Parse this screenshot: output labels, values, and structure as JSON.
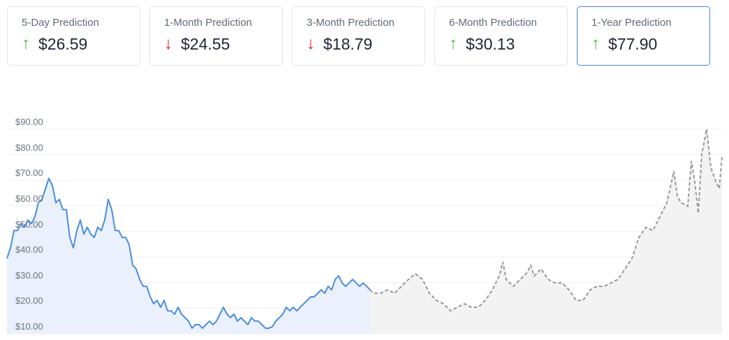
{
  "cards": [
    {
      "title": "5-Day Prediction",
      "value": "$26.59",
      "dir": "up"
    },
    {
      "title": "1-Month Prediction",
      "value": "$24.55",
      "dir": "down"
    },
    {
      "title": "3-Month Prediction",
      "value": "$18.79",
      "dir": "down"
    },
    {
      "title": "6-Month Prediction",
      "value": "$30.13",
      "dir": "up"
    },
    {
      "title": "1-Year Prediction",
      "value": "$77.90",
      "dir": "up",
      "selected": true
    }
  ],
  "arrows": {
    "up": "↑",
    "down": "↓"
  },
  "colors": {
    "historical": "#4a8ce0",
    "historical_fill": "#eaf1fc",
    "forecast": "#999999",
    "forecast_fill": "#f3f3f3",
    "grid": "#eef0f3"
  },
  "chart_data": {
    "type": "line",
    "ylim": [
      10,
      90
    ],
    "y_ticks": [
      "$10.00",
      "$20.00",
      "$30.00",
      "$40.00",
      "$50.00",
      "$60.00",
      "$70.00",
      "$80.00",
      "$90.00"
    ],
    "series": [
      {
        "name": "historical",
        "values": [
          38.9,
          43.0,
          49.8,
          49.8,
          52.5,
          51.1,
          53.9,
          52.5,
          55.2,
          60.7,
          62.0,
          66.1,
          70.2,
          67.5,
          60.7,
          62.0,
          58.0,
          58.0,
          47.1,
          43.0,
          49.8,
          53.9,
          48.4,
          51.1,
          48.4,
          47.1,
          51.1,
          49.8,
          53.9,
          62.0,
          58.0,
          49.8,
          49.8,
          47.1,
          47.1,
          44.3,
          36.2,
          34.8,
          30.7,
          28.0,
          28.0,
          23.9,
          21.2,
          22.5,
          19.8,
          22.5,
          18.4,
          18.4,
          17.1,
          19.8,
          17.1,
          15.7,
          14.4,
          11.6,
          13.0,
          13.0,
          11.6,
          13.0,
          14.4,
          13.0,
          14.4,
          17.1,
          19.8,
          17.1,
          15.7,
          17.1,
          14.4,
          15.7,
          14.4,
          13.0,
          15.7,
          14.4,
          14.4,
          13.0,
          11.6,
          11.6,
          12.2,
          14.4,
          15.7,
          17.1,
          19.8,
          18.4,
          19.8,
          18.4,
          19.8,
          21.2,
          22.5,
          23.9,
          23.9,
          25.3,
          26.6,
          25.3,
          28.0,
          26.6,
          30.7,
          32.1,
          29.3,
          28.0,
          29.3,
          30.7,
          29.3,
          28.0,
          29.3,
          28.0,
          26.6
        ]
      },
      {
        "name": "forecast",
        "points": [
          [
            104,
            26.6
          ],
          [
            105,
            25.3
          ],
          [
            107,
            25.3
          ],
          [
            109,
            26.6
          ],
          [
            111,
            25.3
          ],
          [
            113,
            28.0
          ],
          [
            115,
            30.7
          ],
          [
            117,
            32.9
          ],
          [
            119,
            30.7
          ],
          [
            121,
            25.3
          ],
          [
            123,
            22.5
          ],
          [
            125,
            21.2
          ],
          [
            127,
            18.4
          ],
          [
            129,
            19.8
          ],
          [
            131,
            21.2
          ],
          [
            133,
            19.8
          ],
          [
            135,
            19.8
          ],
          [
            137,
            22.5
          ],
          [
            139,
            26.6
          ],
          [
            141,
            32.1
          ],
          [
            142,
            37.5
          ],
          [
            143,
            30.7
          ],
          [
            145,
            28.0
          ],
          [
            147,
            30.7
          ],
          [
            149,
            33.4
          ],
          [
            150,
            36.2
          ],
          [
            151,
            32.1
          ],
          [
            153,
            34.8
          ],
          [
            155,
            30.7
          ],
          [
            157,
            29.3
          ],
          [
            159,
            29.3
          ],
          [
            161,
            26.6
          ],
          [
            163,
            22.5
          ],
          [
            165,
            22.5
          ],
          [
            167,
            26.6
          ],
          [
            169,
            28.0
          ],
          [
            171,
            28.0
          ],
          [
            173,
            29.3
          ],
          [
            175,
            30.7
          ],
          [
            177,
            34.8
          ],
          [
            179,
            38.9
          ],
          [
            181,
            47.1
          ],
          [
            183,
            51.1
          ],
          [
            185,
            49.8
          ],
          [
            187,
            55.2
          ],
          [
            189,
            60.7
          ],
          [
            191,
            73.0
          ],
          [
            192,
            63.4
          ],
          [
            193,
            60.7
          ],
          [
            195,
            59.3
          ],
          [
            196,
            77.0
          ],
          [
            197,
            68.9
          ],
          [
            198,
            56.6
          ],
          [
            199,
            79.8
          ],
          [
            200.4,
            89.4
          ],
          [
            201.6,
            74.4
          ],
          [
            203,
            69.0
          ],
          [
            204,
            66.2
          ],
          [
            204.8,
            78.5
          ]
        ]
      }
    ]
  }
}
